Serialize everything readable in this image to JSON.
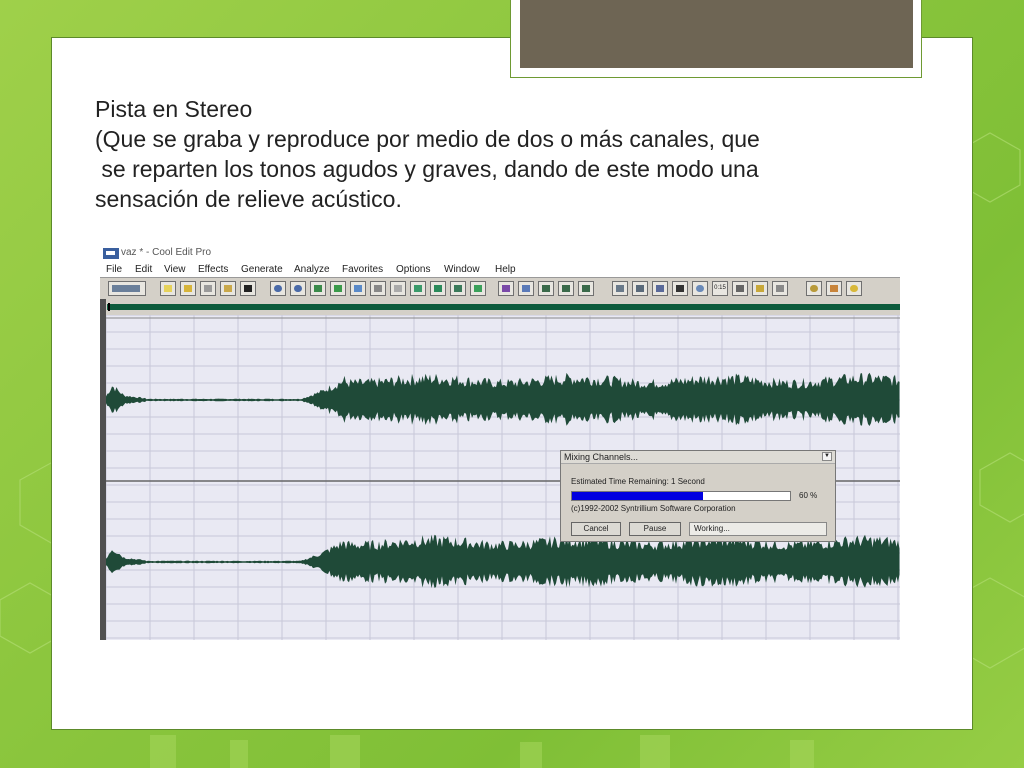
{
  "slide": {
    "text_lines": [
      "Pista en Stereo",
      "(Que se graba y reproduce por medio de dos o más canales, que",
      " se reparten los tonos agudos y graves, dando de este modo una",
      "sensación de relieve acústico."
    ]
  },
  "app": {
    "title": "vaz * - Cool Edit Pro",
    "menu": [
      "File",
      "Edit",
      "View",
      "Effects",
      "Generate",
      "Analyze",
      "Favorites",
      "Options",
      "Window",
      "Help"
    ],
    "toolbar_time_label": "0:15"
  },
  "dialog": {
    "title": "Mixing Channels...",
    "estimate": "Estimated Time Remaining: 1 Second",
    "progress_percent": 60,
    "progress_label": "60 %",
    "copyright": "(c)1992-2002 Syntrillium Software Corporation",
    "cancel_label": "Cancel",
    "pause_label": "Pause",
    "status": "Working...",
    "drop_icon": "chevron-down-icon"
  },
  "colors": {
    "waveform": "#1f4a38",
    "progress": "#0000e0",
    "grid": "#c8c8d8",
    "tab": "#6e6554"
  }
}
